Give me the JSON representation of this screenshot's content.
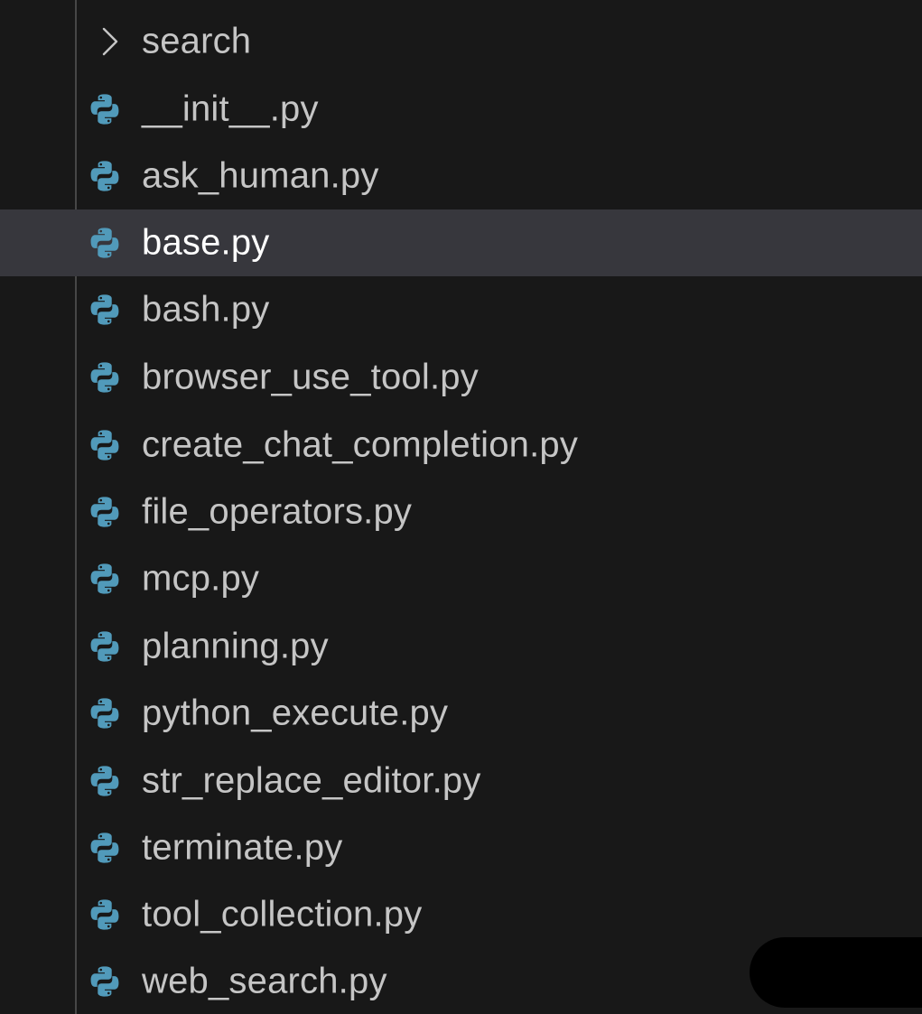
{
  "explorer": {
    "folder": {
      "label": "search",
      "icon": "chevron-right-icon",
      "expanded": false
    },
    "files": [
      {
        "label": "__init__.py",
        "icon": "python-icon",
        "selected": false
      },
      {
        "label": "ask_human.py",
        "icon": "python-icon",
        "selected": false
      },
      {
        "label": "base.py",
        "icon": "python-icon",
        "selected": true
      },
      {
        "label": "bash.py",
        "icon": "python-icon",
        "selected": false
      },
      {
        "label": "browser_use_tool.py",
        "icon": "python-icon",
        "selected": false
      },
      {
        "label": "create_chat_completion.py",
        "icon": "python-icon",
        "selected": false
      },
      {
        "label": "file_operators.py",
        "icon": "python-icon",
        "selected": false
      },
      {
        "label": "mcp.py",
        "icon": "python-icon",
        "selected": false
      },
      {
        "label": "planning.py",
        "icon": "python-icon",
        "selected": false
      },
      {
        "label": "python_execute.py",
        "icon": "python-icon",
        "selected": false
      },
      {
        "label": "str_replace_editor.py",
        "icon": "python-icon",
        "selected": false
      },
      {
        "label": "terminate.py",
        "icon": "python-icon",
        "selected": false
      },
      {
        "label": "tool_collection.py",
        "icon": "python-icon",
        "selected": false
      },
      {
        "label": "web_search.py",
        "icon": "python-icon",
        "selected": false
      }
    ]
  },
  "colors": {
    "background": "#181818",
    "selected_row": "#37373d",
    "text": "#c5c5c5",
    "selected_text": "#ffffff",
    "python_icon": "#519aba",
    "indent_guide": "#474747"
  }
}
